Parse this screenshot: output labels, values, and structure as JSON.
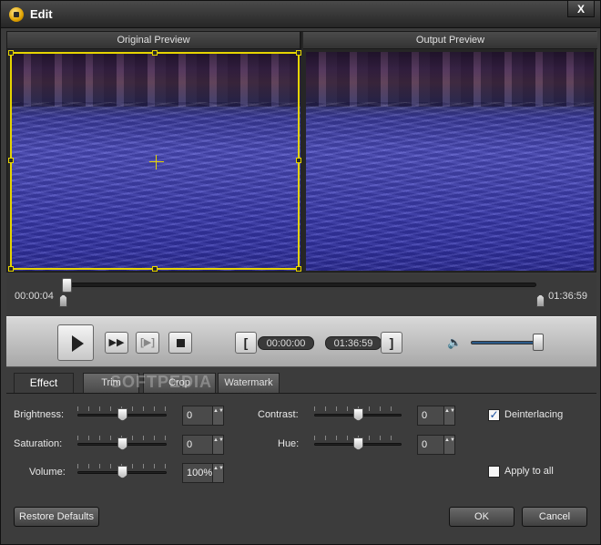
{
  "window": {
    "title": "Edit",
    "close_label": "X"
  },
  "preview": {
    "original_label": "Original Preview",
    "output_label": "Output Preview"
  },
  "timeline": {
    "start_time": "00:00:04",
    "end_time": "01:36:59",
    "position_fraction": 0.0
  },
  "controls": {
    "ff_label": "▶▶",
    "frame_label": "[▶]",
    "bracket_left": "[",
    "bracket_right": "]",
    "clip_start": "00:00:00",
    "clip_end": "01:36:59",
    "speaker_icon": "🔈",
    "volume_fraction": 0.9
  },
  "tabs": [
    {
      "label": "Effect",
      "active": true
    },
    {
      "label": "Trim",
      "active": false
    },
    {
      "label": "Crop",
      "active": false
    },
    {
      "label": "Watermark",
      "active": false
    }
  ],
  "watermark": "SOFTPEDIA",
  "effect": {
    "brightness": {
      "label": "Brightness:",
      "value": "0"
    },
    "saturation": {
      "label": "Saturation:",
      "value": "0"
    },
    "volume": {
      "label": "Volume:",
      "value": "100%"
    },
    "contrast": {
      "label": "Contrast:",
      "value": "0"
    },
    "hue": {
      "label": "Hue:",
      "value": "0"
    },
    "deinterlacing": {
      "label": "Deinterlacing",
      "checked": true,
      "check": "✓"
    },
    "apply_all": {
      "label": "Apply to all",
      "checked": false,
      "check": ""
    }
  },
  "footer": {
    "restore_label": "Restore Defaults",
    "ok_label": "OK",
    "cancel_label": "Cancel"
  },
  "spin_arrows": "▲▼",
  "colors": {
    "crop_frame": "#e6d400",
    "accent": "#6aa8e8"
  }
}
